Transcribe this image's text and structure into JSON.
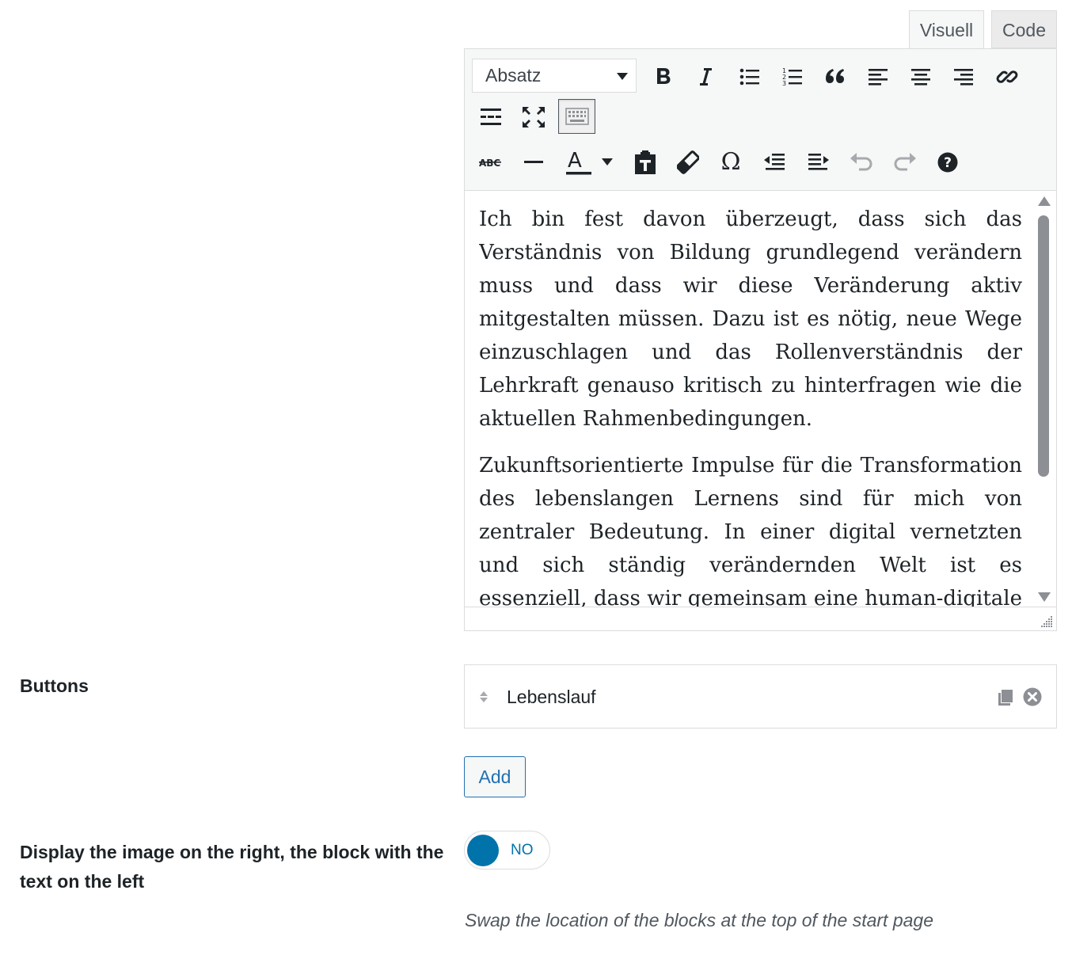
{
  "editor": {
    "tabs": {
      "visual": "Visuell",
      "code": "Code"
    },
    "format_select": "Absatz",
    "toolbar_icons": [
      "bold-icon",
      "italic-icon",
      "bullet-list-icon",
      "numbered-list-icon",
      "blockquote-icon",
      "align-left-icon",
      "align-center-icon",
      "align-right-icon",
      "link-icon",
      "read-more-icon",
      "fullscreen-icon",
      "toolbar-toggle-icon",
      "strikethrough-icon",
      "horizontal-line-icon",
      "text-color-icon",
      "paste-text-icon",
      "clear-formatting-icon",
      "special-character-icon",
      "outdent-icon",
      "indent-icon",
      "undo-icon",
      "redo-icon",
      "help-icon"
    ],
    "content": {
      "paragraph_1": "Ich bin fest davon überzeugt, dass sich das Verständnis von Bildung grundlegend verändern muss und dass wir diese Veränderung aktiv mitgestalten müssen. Dazu ist es nötig, neue Wege einzuschlagen und das Rollenverständnis der Lehrkraft genauso kritisch zu hinterfragen wie die aktuellen Rahmenbedingungen.",
      "paragraph_2": "Zukunftsorientierte Impulse für die Transformation des lebenslangen Lernens sind für mich von zentraler Bedeutung. In einer digital vernetzten und sich ständig verändernden Welt ist es essenziell, dass wir gemeinsam eine human-digitale Zukunft gestalten, in der Technologie menschliche Fähigkeiten unterstützt"
    }
  },
  "buttons_field": {
    "label": "Buttons",
    "items": [
      {
        "title": "Lebenslauf"
      }
    ],
    "add_label": "Add"
  },
  "display_field": {
    "label": "Display the image on the right, the block with the text on the left",
    "toggle_text": "NO",
    "description": "Swap the location of the blocks at the top of the start page"
  },
  "colors": {
    "accent": "#0073aa",
    "button": "#2271b1",
    "border": "#dcdcde",
    "toolbar_bg": "#f6f7f7"
  }
}
